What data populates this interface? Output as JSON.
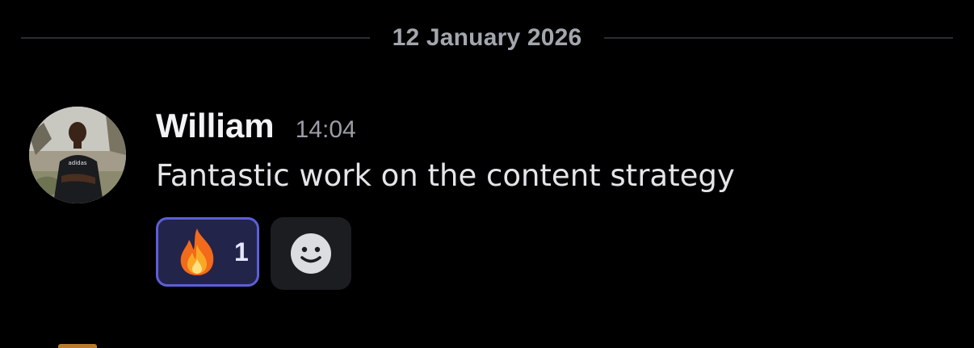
{
  "date_divider": {
    "label": "12 January 2026"
  },
  "message": {
    "author": "William",
    "timestamp": "14:04",
    "text": "Fantastic work on the content strategy",
    "avatar_icon": "user-photo-avatar",
    "avatar_shirt_text": "adidas",
    "reactions": [
      {
        "emoji_icon": "fire-emoji-icon",
        "count": "1",
        "selected": true
      }
    ],
    "add_reaction_icon": "smiley-add-reaction-icon"
  },
  "colors": {
    "background": "#000000",
    "reaction_selected_border": "#5c5fd8",
    "reaction_selected_bg": "#23244a",
    "add_reaction_bg": "#1c1d20"
  }
}
